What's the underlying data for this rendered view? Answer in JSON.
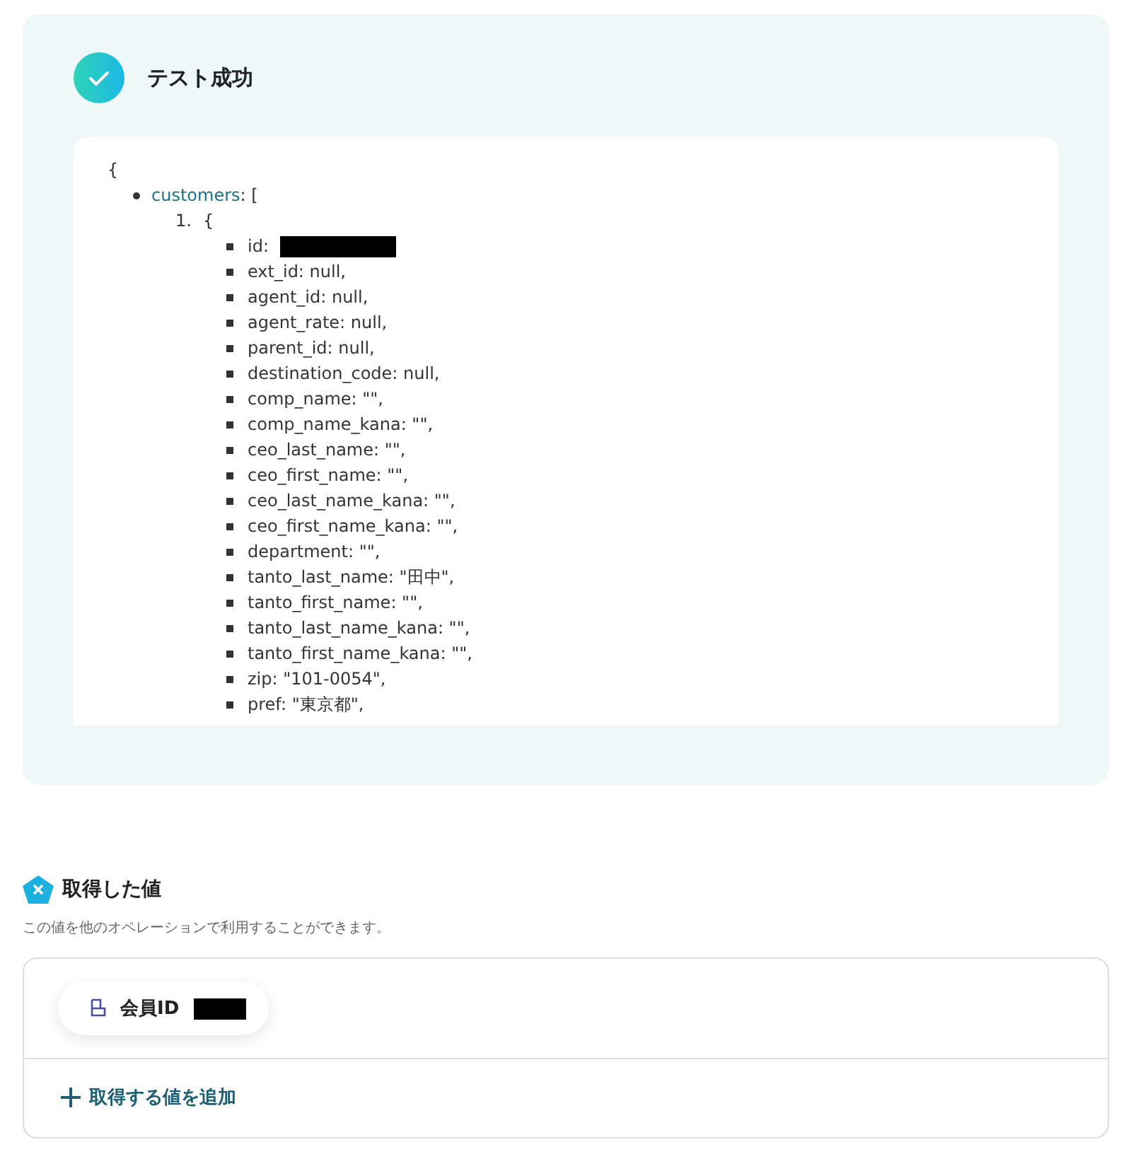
{
  "result": {
    "title": "テスト成功",
    "open_brace": "{",
    "list_key": "customers",
    "list_open": ": [",
    "item_number": "1.",
    "item_open": "{",
    "fields": [
      {
        "text": "id:",
        "redacted": true
      },
      {
        "text": "ext_id: null,",
        "redacted": false
      },
      {
        "text": "agent_id: null,",
        "redacted": false
      },
      {
        "text": "agent_rate: null,",
        "redacted": false
      },
      {
        "text": "parent_id: null,",
        "redacted": false
      },
      {
        "text": "destination_code: null,",
        "redacted": false
      },
      {
        "text": "comp_name: \"\",",
        "redacted": false
      },
      {
        "text": "comp_name_kana: \"\",",
        "redacted": false
      },
      {
        "text": "ceo_last_name: \"\",",
        "redacted": false
      },
      {
        "text": "ceo_first_name: \"\",",
        "redacted": false
      },
      {
        "text": "ceo_last_name_kana: \"\",",
        "redacted": false
      },
      {
        "text": "ceo_first_name_kana: \"\",",
        "redacted": false
      },
      {
        "text": "department: \"\",",
        "redacted": false
      },
      {
        "text": "tanto_last_name: \"田中\",",
        "redacted": false
      },
      {
        "text": "tanto_first_name: \"\",",
        "redacted": false
      },
      {
        "text": "tanto_last_name_kana: \"\",",
        "redacted": false
      },
      {
        "text": "tanto_first_name_kana: \"\",",
        "redacted": false
      },
      {
        "text": "zip: \"101-0054\",",
        "redacted": false
      },
      {
        "text": "pref: \"東京都\",",
        "redacted": false
      }
    ]
  },
  "values": {
    "title": "取得した値",
    "description": "この値を他のオペレーションで利用することができます。",
    "chips": [
      {
        "label": "会員ID",
        "redacted": true
      }
    ],
    "add_button": "取得する値を追加"
  }
}
